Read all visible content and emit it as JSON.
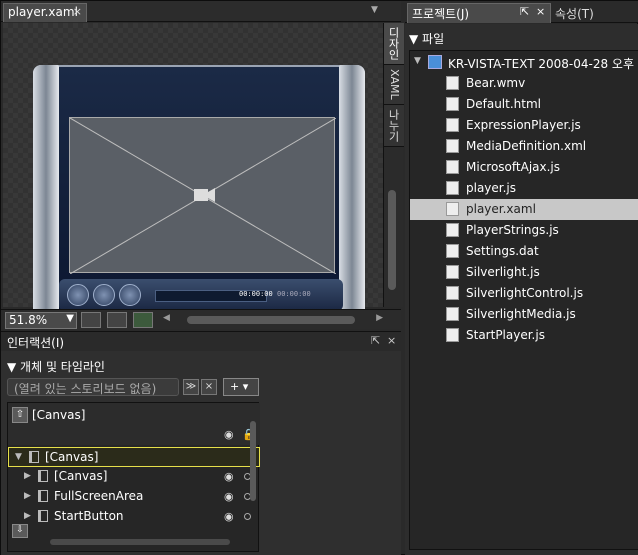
{
  "document": {
    "tab_label": "player.xaml",
    "close_glyph": "×",
    "menu_glyph": "▼",
    "view_tabs": [
      "디자인",
      "XAML",
      "나누기"
    ],
    "zoom_value": "51.8%",
    "player_time_current": "00:00:00",
    "player_time_total": "00:00:00"
  },
  "interaction": {
    "title": "인터랙션(I)",
    "section_title": "▼ 개체 및 타임라인",
    "storyboard_placeholder": "(열려 있는 스토리보드 없음)",
    "add_label": "+ ▾",
    "scope_label": "[Canvas]",
    "nodes": [
      {
        "label": "[Canvas]",
        "selected": true
      },
      {
        "label": "[Canvas]",
        "selected": false
      },
      {
        "label": "FullScreenArea",
        "selected": false
      },
      {
        "label": "StartButton",
        "selected": false
      }
    ]
  },
  "project": {
    "tab_label": "프로젝트(J)",
    "properties_tab_label": "속성(T)",
    "files_heading": "▼ 파일",
    "root_label": "KR-VISTA-TEXT 2008-04-28 오후",
    "files": [
      {
        "name": "Bear.wmv",
        "icon": "video-file-icon",
        "selected": false
      },
      {
        "name": "Default.html",
        "icon": "html-file-icon",
        "selected": false
      },
      {
        "name": "ExpressionPlayer.js",
        "icon": "js-file-icon",
        "selected": false
      },
      {
        "name": "MediaDefinition.xml",
        "icon": "xml-file-icon",
        "selected": false
      },
      {
        "name": "MicrosoftAjax.js",
        "icon": "js-file-icon",
        "selected": false
      },
      {
        "name": "player.js",
        "icon": "js-file-icon",
        "selected": false
      },
      {
        "name": "player.xaml",
        "icon": "xaml-file-icon",
        "selected": true
      },
      {
        "name": "PlayerStrings.js",
        "icon": "js-file-icon",
        "selected": false
      },
      {
        "name": "Settings.dat",
        "icon": "dat-file-icon",
        "selected": false
      },
      {
        "name": "Silverlight.js",
        "icon": "js-file-icon",
        "selected": false
      },
      {
        "name": "SilverlightControl.js",
        "icon": "js-file-icon",
        "selected": false
      },
      {
        "name": "SilverlightMedia.js",
        "icon": "js-file-icon",
        "selected": false
      },
      {
        "name": "StartPlayer.js",
        "icon": "js-file-icon",
        "selected": false
      }
    ]
  },
  "colors": {
    "background": "#2a2a2a",
    "selection_highlight": "#e6e04a",
    "selected_file_bg": "#c8c8c8"
  }
}
